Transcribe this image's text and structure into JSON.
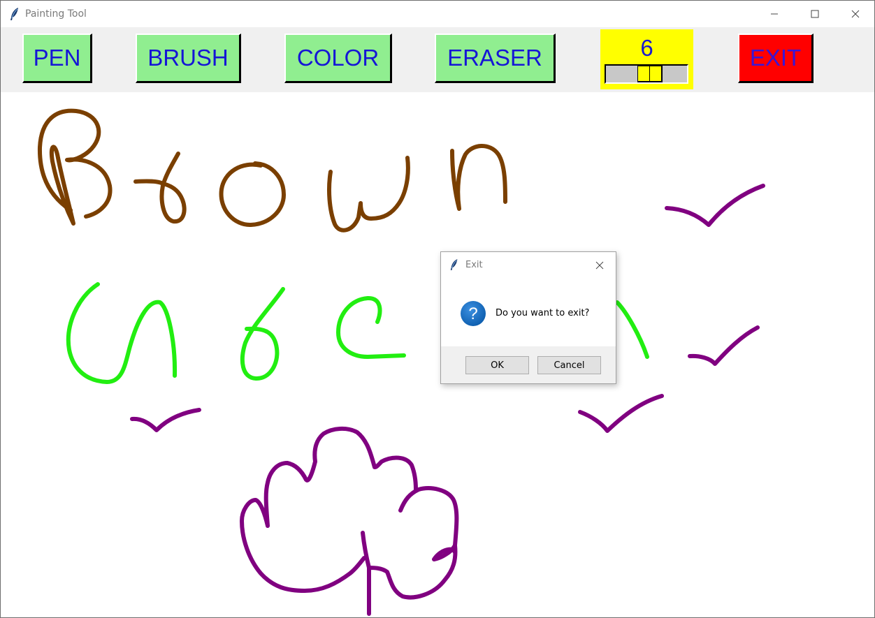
{
  "window": {
    "title": "Painting Tool",
    "controls": [
      "minimize-icon",
      "maximize-icon",
      "close-icon"
    ]
  },
  "toolbar": {
    "pen_label": "PEN",
    "brush_label": "BRUSH",
    "color_label": "COLOR",
    "eraser_label": "ERASER",
    "exit_label": "EXIT",
    "size_value": "6",
    "size_slider_fraction": 0.5,
    "colors": {
      "tool_button_bg": "#90ee90",
      "tool_button_text": "#1515d6",
      "exit_button_bg": "#ff0000",
      "size_box_bg": "#ffff00"
    }
  },
  "canvas": {
    "stroke_colors": {
      "brown": "#7a3f00",
      "green": "#22ee11",
      "purple": "#800080"
    }
  },
  "dialog": {
    "title": "Exit",
    "icon": "question-icon",
    "message": "Do you want to exit?",
    "ok_label": "OK",
    "cancel_label": "Cancel"
  }
}
